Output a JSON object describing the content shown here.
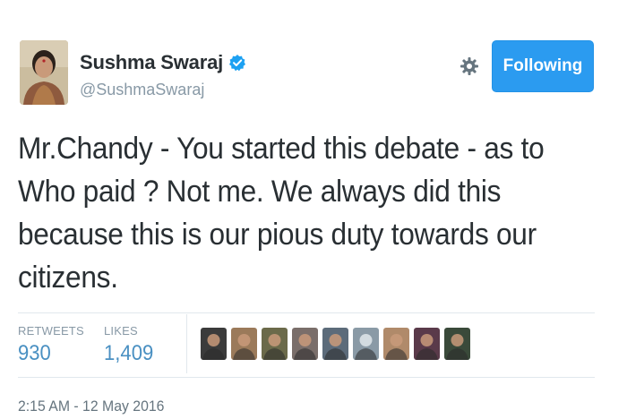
{
  "user": {
    "display_name": "Sushma Swaraj",
    "handle": "@SushmaSwaraj",
    "verified_icon": "verified-badge-icon"
  },
  "actions": {
    "gear_icon": "gear-icon",
    "follow_label": "Following"
  },
  "tweet": {
    "text": "Mr.Chandy - You started this debate - as to\nWho paid ? Not me. We always did this\nbecause this is our pious duty towards our\ncitizens."
  },
  "stats": {
    "retweets_label": "RETWEETS",
    "retweets_value": "930",
    "likes_label": "LIKES",
    "likes_value": "1,409"
  },
  "likers": [
    {
      "icon": "liker-avatar-1",
      "color": "#3b3b3b"
    },
    {
      "icon": "liker-avatar-2",
      "color": "#9b7a5a"
    },
    {
      "icon": "liker-avatar-3",
      "color": "#6b6a4a"
    },
    {
      "icon": "liker-avatar-4",
      "color": "#7a6e6a"
    },
    {
      "icon": "liker-avatar-5",
      "color": "#5c6b7a"
    },
    {
      "icon": "liker-avatar-6",
      "color": "#8a9aa6"
    },
    {
      "icon": "liker-avatar-7",
      "color": "#b08a6a"
    },
    {
      "icon": "liker-avatar-8",
      "color": "#5a3a4a"
    },
    {
      "icon": "liker-avatar-9",
      "color": "#3a4a3a"
    }
  ],
  "meta": {
    "timestamp": "2:15 AM - 12 May 2016"
  },
  "colors": {
    "accent": "#2b9bf0",
    "stat_value": "#4a90c2",
    "muted": "#8899a6"
  }
}
